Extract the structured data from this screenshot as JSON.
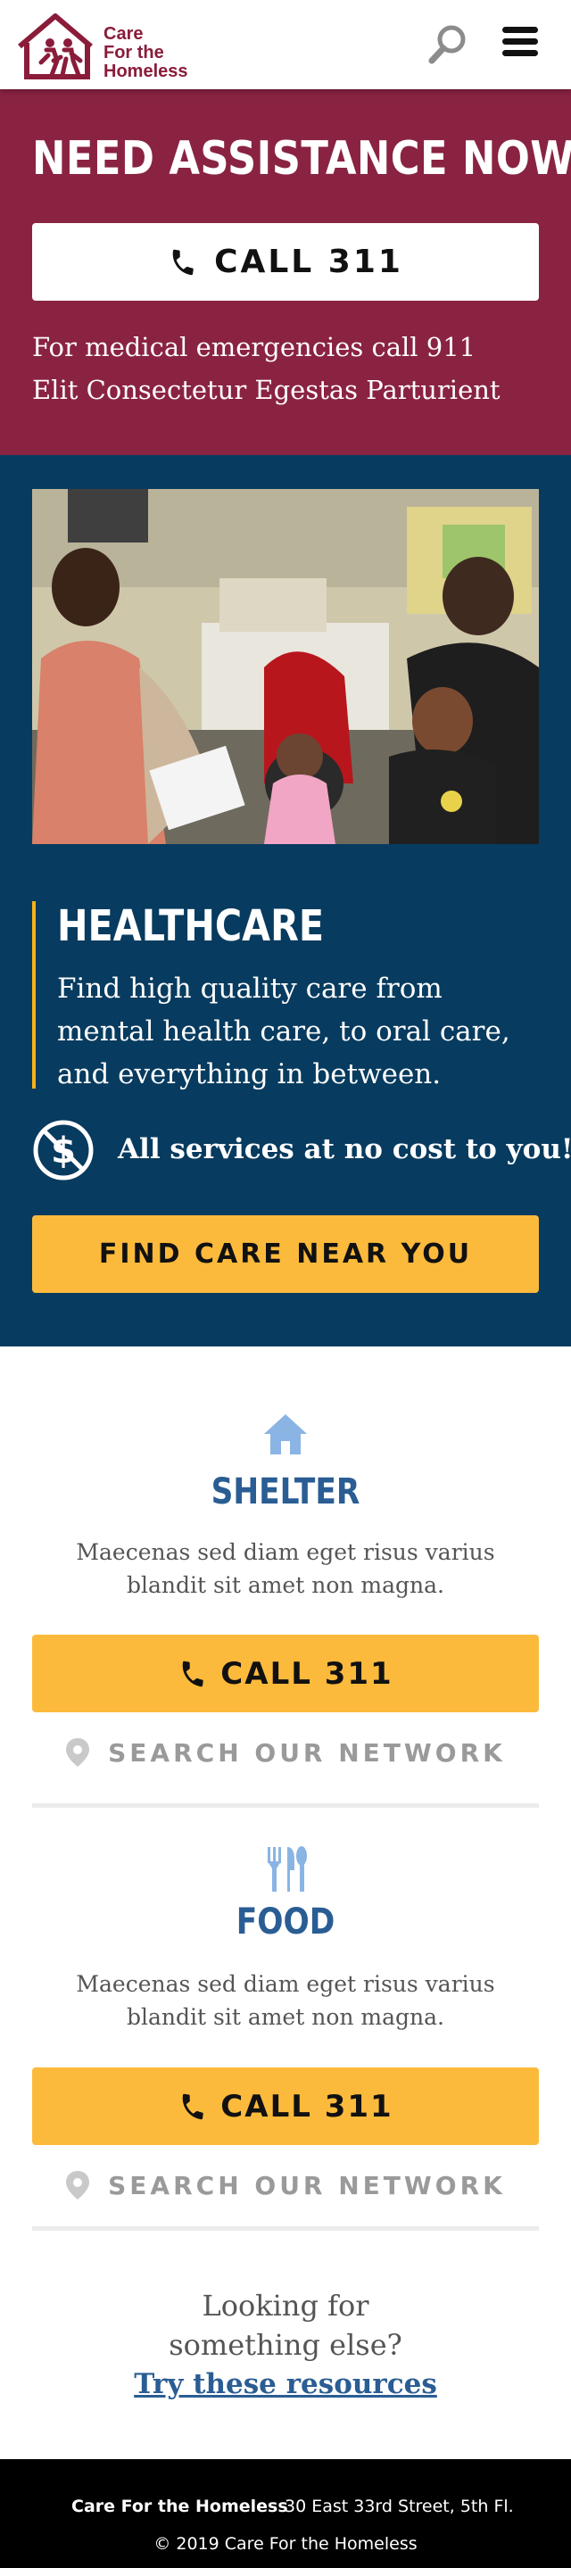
{
  "header": {
    "logo_line1": "Care",
    "logo_line2": "For the",
    "logo_line3": "Homeless",
    "search_icon": "search-icon",
    "menu_icon": "hamburger-menu-icon"
  },
  "assistance": {
    "heading": "NEED ASSISTANCE NOW?",
    "call_label": "CALL 311",
    "line1": "For medical emergencies call 911",
    "line2": "Elit Consectetur Egestas Parturient"
  },
  "healthcare": {
    "title": "HEALTHCARE",
    "description": "Find high quality care from mental health care, to oral care, and everything in between.",
    "no_cost": "All services at no cost to you!",
    "find_button": "FIND CARE NEAR YOU"
  },
  "shelter": {
    "title": "SHELTER",
    "description": "Maecenas sed diam eget risus varius blandit sit amet non magna.",
    "call_label": "CALL 311",
    "network_label": "SEARCH OUR NETWORK"
  },
  "food": {
    "title": "FOOD",
    "description": "Maecenas sed diam eget risus varius blandit sit amet non magna.",
    "call_label": "CALL 311",
    "network_label": "SEARCH OUR NETWORK"
  },
  "looking": {
    "line1": "Looking for",
    "line2": "something else?",
    "link": "Try these resources"
  },
  "footer": {
    "org": "Care For the Homeless",
    "address": "30 East 33rd Street, 5th Fl.",
    "copyright": "© 2019 Care For the Homeless"
  },
  "colors": {
    "brand_maroon": "#8a2342",
    "navy": "#073b5f",
    "accent_yellow": "#fcba3c",
    "link_blue": "#2a5d93"
  }
}
